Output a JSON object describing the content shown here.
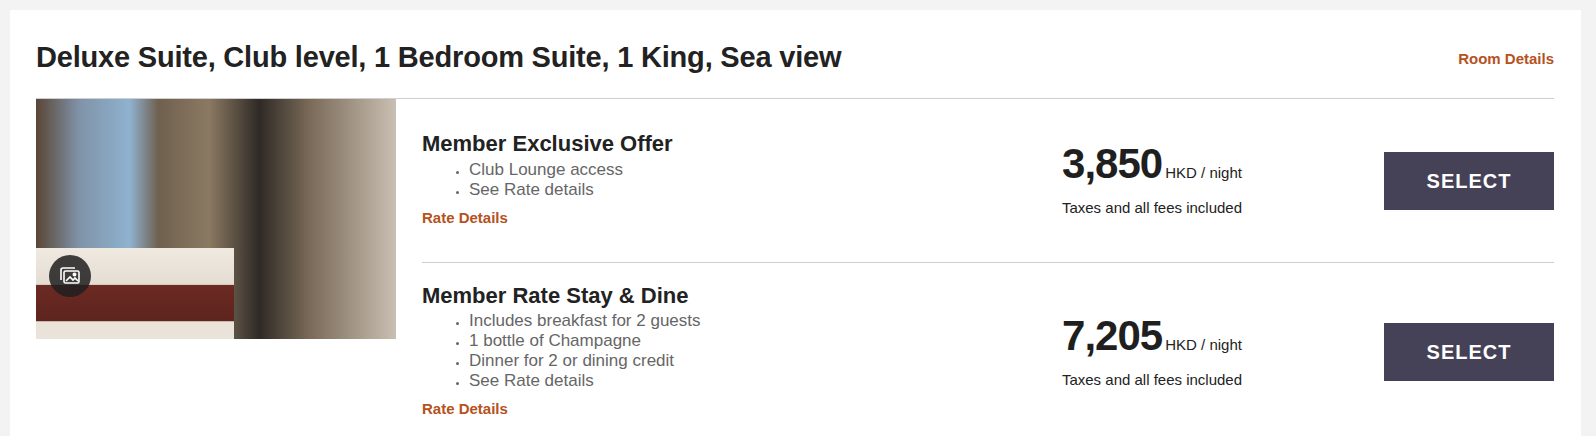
{
  "room": {
    "title": "Deluxe Suite, Club level, 1 Bedroom Suite, 1 King, Sea view",
    "details_link": "Room Details"
  },
  "offers": [
    {
      "name": "Member Exclusive Offer",
      "features": [
        "Club Lounge access",
        "See Rate details"
      ],
      "rate_link": "Rate Details",
      "price": "3,850",
      "unit": "HKD / night",
      "note": "Taxes and all fees included",
      "button": "SELECT"
    },
    {
      "name": "Member Rate Stay & Dine",
      "features": [
        "Includes breakfast for 2 guests",
        "1 bottle of Champagne",
        "Dinner for 2 or dining credit",
        "See Rate details"
      ],
      "rate_link": "Rate Details",
      "price": "7,205",
      "unit": "HKD / night",
      "note": "Taxes and all fees included",
      "button": "SELECT"
    }
  ]
}
